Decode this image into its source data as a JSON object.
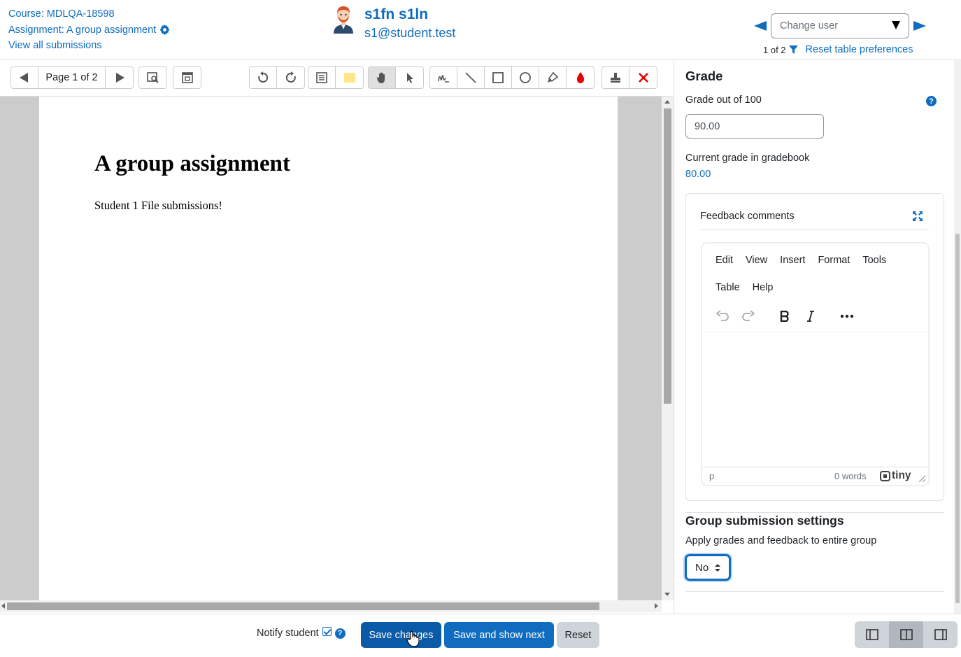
{
  "header": {
    "course": "Course: MDLQA-18598",
    "assignment": "Assignment: A group assignment",
    "view_all": "View all submissions",
    "user_name": "s1fn s1ln",
    "user_email": "s1@student.test",
    "change_user_placeholder": "Change user",
    "counter": "1 of 2",
    "reset_prefs": "Reset table preferences"
  },
  "editor": {
    "page_label": "Page 1 of 2",
    "pdf_title": "A group assignment",
    "pdf_text": "Student 1 File submissions!"
  },
  "grade": {
    "title": "Grade",
    "grade_label": "Grade out of 100",
    "grade_value": "90.00",
    "gradebook_label": "Current grade in gradebook",
    "gradebook_value": "80.00",
    "help_glyph": "?"
  },
  "feedback": {
    "title": "Feedback comments",
    "menu": [
      "Edit",
      "View",
      "Insert",
      "Format",
      "Tools",
      "Table",
      "Help"
    ],
    "status_path": "p",
    "word_count": "0 words",
    "logo": "tiny"
  },
  "group": {
    "title": "Group submission settings",
    "label": "Apply grades and feedback to entire group",
    "value": "No"
  },
  "footer": {
    "notify_label": "Notify student",
    "save": "Save changes",
    "save_next": "Save and show next",
    "reset": "Reset"
  },
  "colors": {
    "link": "#0f6cbf",
    "primary_button": "#0f6cbf",
    "secondary_button": "#ced4da",
    "annotation_red": "#e60000"
  }
}
